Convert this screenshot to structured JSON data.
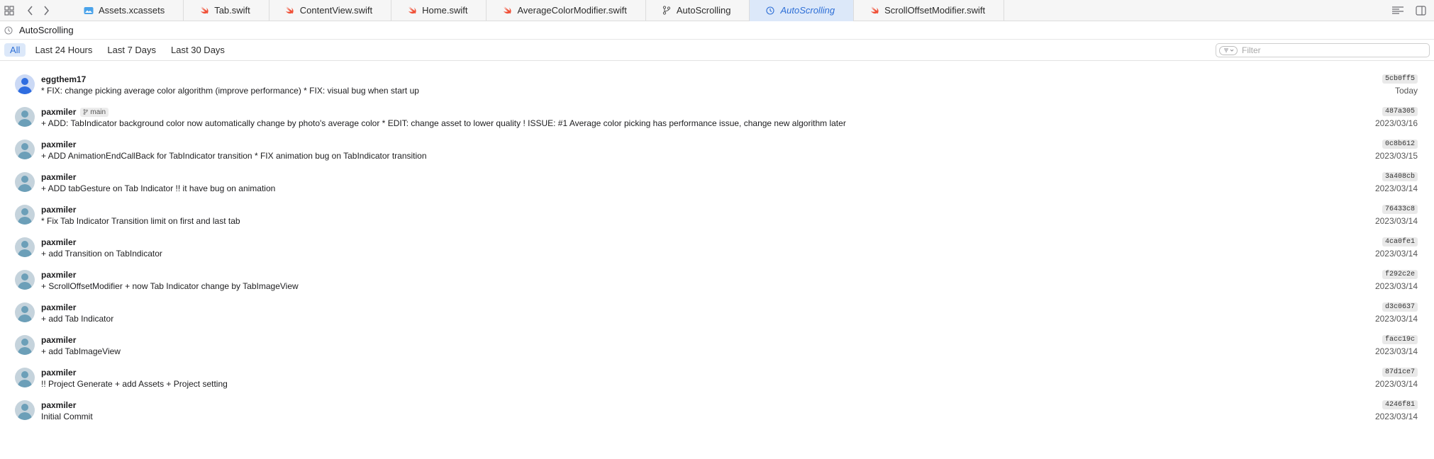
{
  "tabs": [
    {
      "label": "Assets.xcassets",
      "icon": "asset-catalog-icon",
      "active": false
    },
    {
      "label": "Tab.swift",
      "icon": "swift-icon",
      "active": false
    },
    {
      "label": "ContentView.swift",
      "icon": "swift-icon",
      "active": false
    },
    {
      "label": "Home.swift",
      "icon": "swift-icon",
      "active": false
    },
    {
      "label": "AverageColorModifier.swift",
      "icon": "swift-icon",
      "active": false
    },
    {
      "label": "AutoScrolling",
      "icon": "branch-icon",
      "active": false
    },
    {
      "label": "AutoScrolling",
      "icon": "clock-icon",
      "active": true
    },
    {
      "label": "ScrollOffsetModifier.swift",
      "icon": "swift-icon",
      "active": false
    }
  ],
  "breadcrumb": {
    "label": "AutoScrolling"
  },
  "filters": {
    "segments": [
      "All",
      "Last 24 Hours",
      "Last 7 Days",
      "Last 30 Days"
    ],
    "selected": "All",
    "search_placeholder": "Filter"
  },
  "commits": [
    {
      "author": "eggthem17",
      "branch": "",
      "message": "* FIX: change picking average color algorithm (improve performance) * FIX: visual bug when start up",
      "hash": "5cb0ff5",
      "date": "Today",
      "self": true
    },
    {
      "author": "paxmiler",
      "branch": "main",
      "message": "+ ADD: TabIndicator background color now automatically change by photo's average color * EDIT: change asset to lower quality ! ISSUE: #1 Average color picking has performance issue, change new algorithm later",
      "hash": "487a305",
      "date": "2023/03/16",
      "self": false
    },
    {
      "author": "paxmiler",
      "branch": "",
      "message": "+ ADD AnimationEndCallBack for TabIndicator transition * FIX animation bug on TabIndicator transition",
      "hash": "0c8b612",
      "date": "2023/03/15",
      "self": false
    },
    {
      "author": "paxmiler",
      "branch": "",
      "message": "+ ADD tabGesture on Tab Indicator !! it have bug on animation",
      "hash": "3a408cb",
      "date": "2023/03/14",
      "self": false
    },
    {
      "author": "paxmiler",
      "branch": "",
      "message": "* Fix Tab Indicator Transition limit on first and last tab",
      "hash": "76433c8",
      "date": "2023/03/14",
      "self": false
    },
    {
      "author": "paxmiler",
      "branch": "",
      "message": "+ add Transition on TabIndicator",
      "hash": "4ca0fe1",
      "date": "2023/03/14",
      "self": false
    },
    {
      "author": "paxmiler",
      "branch": "",
      "message": "+ ScrollOffsetModifier + now Tab Indicator change by TabImageView",
      "hash": "f292c2e",
      "date": "2023/03/14",
      "self": false
    },
    {
      "author": "paxmiler",
      "branch": "",
      "message": "+ add Tab Indicator",
      "hash": "d3c0637",
      "date": "2023/03/14",
      "self": false
    },
    {
      "author": "paxmiler",
      "branch": "",
      "message": "+ add TabImageView",
      "hash": "facc19c",
      "date": "2023/03/14",
      "self": false
    },
    {
      "author": "paxmiler",
      "branch": "",
      "message": "!! Project Generate + add Assets + Project setting",
      "hash": "87d1ce7",
      "date": "2023/03/14",
      "self": false
    },
    {
      "author": "paxmiler",
      "branch": "",
      "message": "Initial Commit",
      "hash": "4246f81",
      "date": "2023/03/14",
      "self": false
    }
  ],
  "colors": {
    "accent": "#2e6fd6",
    "selected_bg": "#dce8f9",
    "swift": "#f05138"
  }
}
